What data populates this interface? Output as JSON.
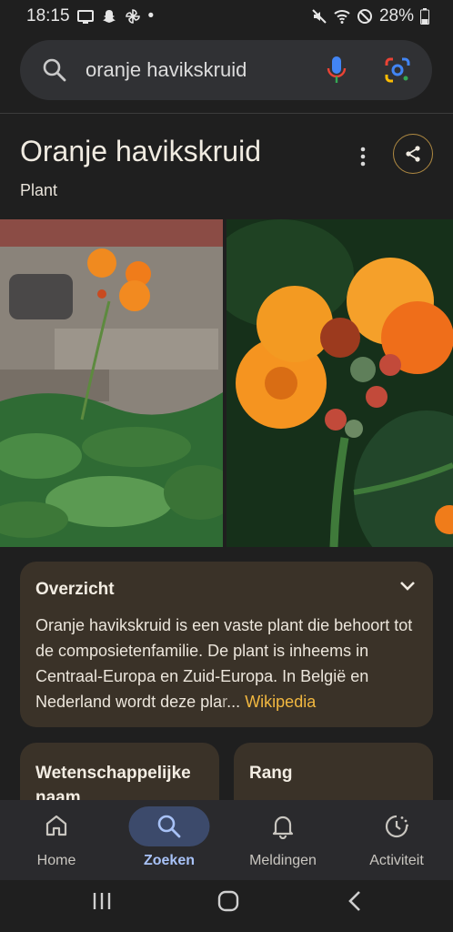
{
  "status": {
    "time": "18:15",
    "dot": "•",
    "battery": "28%"
  },
  "search": {
    "query": "oranje havikskruid",
    "icon": "search-icon"
  },
  "entity": {
    "title": "Oranje havikskruid",
    "subtitle": "Plant"
  },
  "overview": {
    "title": "Overzicht",
    "text": "Oranje havikskruid is een vaste plant die behoort tot de composietenfamilie. De plant is inheems in Centraal-Europa en Zuid-Europa. In België en Nederland wordt deze pla",
    "faded": "r",
    "ellipsis": "...",
    "link": "Wikipedia"
  },
  "cards": {
    "scientific_name": "Wetenschappelijke naam",
    "rank": "Rang"
  },
  "nav": {
    "items": [
      {
        "label": "Home",
        "icon": "home-icon"
      },
      {
        "label": "Zoeken",
        "icon": "search-icon",
        "active": true
      },
      {
        "label": "Meldingen",
        "icon": "bell-icon"
      },
      {
        "label": "Activiteit",
        "icon": "activity-icon"
      }
    ]
  },
  "colors": {
    "background": "#1f1f1f",
    "card": "#3a3228",
    "link": "#f2b840",
    "active_nav": "#a8c2f7"
  }
}
